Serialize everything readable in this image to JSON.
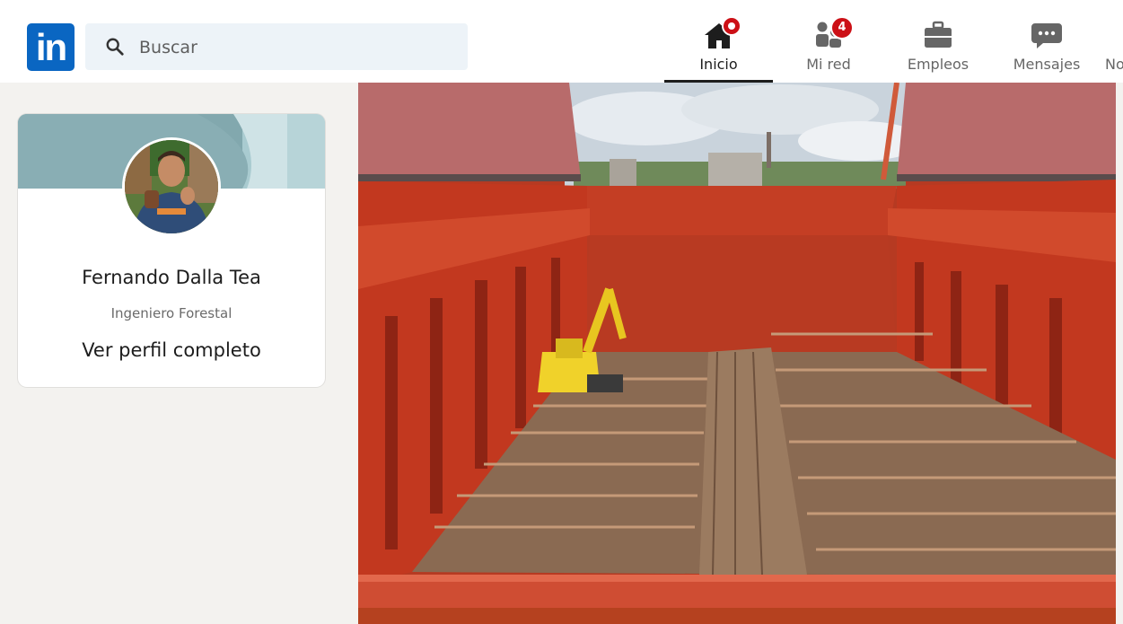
{
  "header": {
    "logo_text": "in",
    "search": {
      "placeholder": "Buscar",
      "value": ""
    },
    "nav": [
      {
        "id": "home",
        "label": "Inicio",
        "icon": "home-icon",
        "active": true,
        "badge": ""
      },
      {
        "id": "network",
        "label": "Mi red",
        "icon": "people-icon",
        "active": false,
        "badge": "4"
      },
      {
        "id": "jobs",
        "label": "Empleos",
        "icon": "briefcase-icon",
        "active": false,
        "badge": ""
      },
      {
        "id": "messages",
        "label": "Mensajes",
        "icon": "chat-icon",
        "active": false,
        "badge": ""
      },
      {
        "id": "notifications",
        "label": "No",
        "icon": "",
        "active": false,
        "badge": ""
      }
    ]
  },
  "profile": {
    "name": "Fernando Dalla Tea",
    "headline": "Ingeniero Forestal",
    "link_label": "Ver perfil completo"
  },
  "colors": {
    "brand": "#0a66c2",
    "badge": "#cc1016",
    "search_bg": "#edf3f8",
    "page_bg": "#f3f2ef"
  }
}
